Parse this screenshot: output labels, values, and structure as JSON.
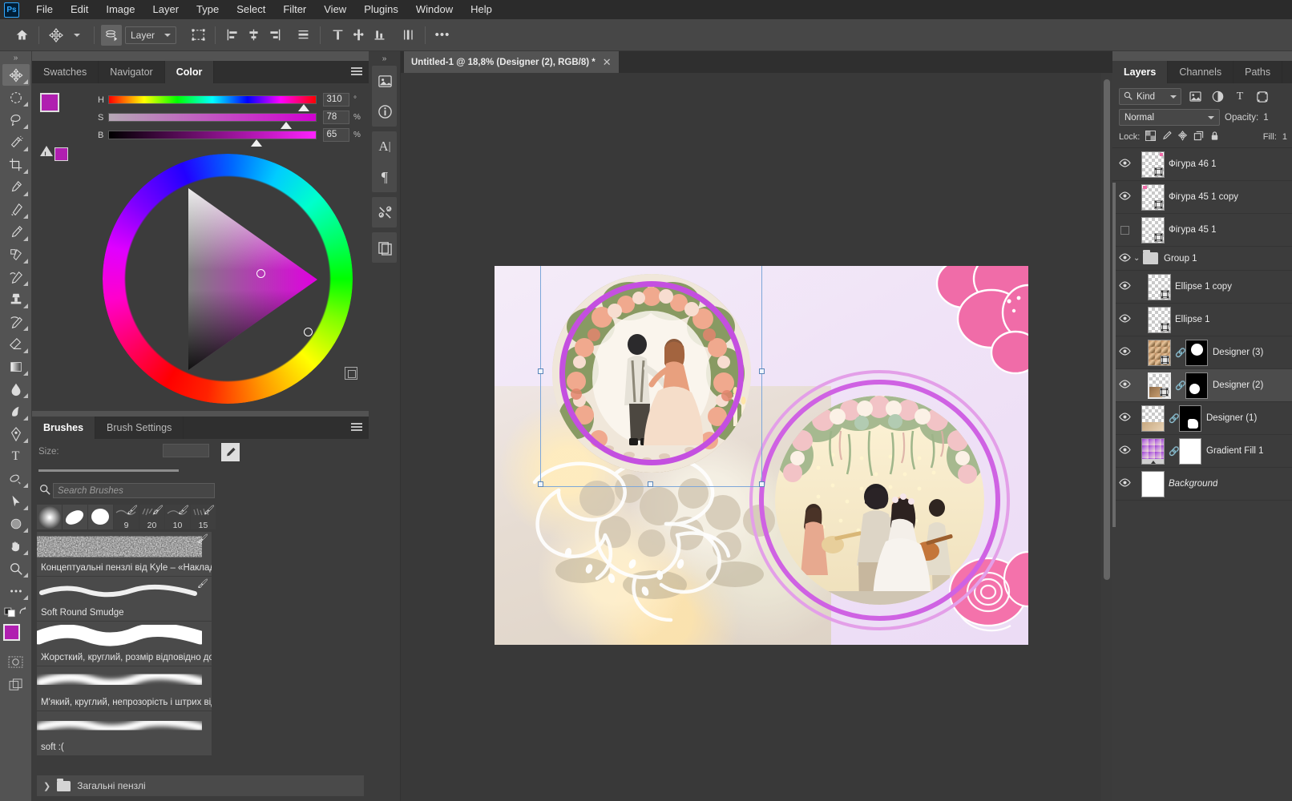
{
  "menubar": {
    "logo": "Ps",
    "items": [
      "File",
      "Edit",
      "Image",
      "Layer",
      "Type",
      "Select",
      "Filter",
      "View",
      "Plugins",
      "Window",
      "Help"
    ]
  },
  "optionsbar": {
    "home_icon": "home-icon",
    "tool_icon": "move-tool-icon",
    "autoselect_icon": "auto-select-icon",
    "layer_select_value": "Layer",
    "transform_icon": "show-transform-controls-icon",
    "align_icons": [
      "align-left-edges-icon",
      "align-horizontal-centers-icon",
      "align-right-edges-icon",
      "align-top-edges-icon"
    ],
    "distribute_icons": [
      "distribute-top-edges-icon",
      "distribute-vertical-centers-icon",
      "distribute-bottom-edges-icon",
      "distribute-left-edges-icon"
    ],
    "more_label": "•••"
  },
  "toolbar": {
    "collapse_label": "»",
    "tools": [
      {
        "name": "move-tool",
        "glyph": "move",
        "active": true
      },
      {
        "name": "elliptical-marquee-tool",
        "glyph": "marquee"
      },
      {
        "name": "lasso-tool",
        "glyph": "lasso"
      },
      {
        "name": "magic-wand-tool",
        "glyph": "wand"
      },
      {
        "name": "crop-tool",
        "glyph": "crop"
      },
      {
        "name": "eyedropper-tool",
        "glyph": "eyedropper"
      },
      {
        "name": "spot-healing-brush-tool",
        "glyph": "healing"
      },
      {
        "name": "brush-tool",
        "glyph": "brush"
      },
      {
        "name": "clone-stamp-tool",
        "glyph": "stamp-pattern"
      },
      {
        "name": "history-brush-tool",
        "glyph": "history-brush"
      },
      {
        "name": "clone-stamp",
        "glyph": "stamp"
      },
      {
        "name": "eraser-tool",
        "glyph": "eraser-alt"
      },
      {
        "name": "gradient-tool",
        "glyph": "gradient"
      },
      {
        "name": "blur-tool",
        "glyph": "blur"
      },
      {
        "name": "dodge-tool",
        "glyph": "dodge"
      },
      {
        "name": "pen-tool",
        "glyph": "pen"
      },
      {
        "name": "type-tool",
        "glyph": "T"
      },
      {
        "name": "path-selection-tool",
        "glyph": "path-sel"
      },
      {
        "name": "direct-selection-tool",
        "glyph": "arrow"
      },
      {
        "name": "ellipse-tool",
        "glyph": "ellipse"
      },
      {
        "name": "hand-tool",
        "glyph": "hand"
      },
      {
        "name": "zoom-tool",
        "glyph": "zoom"
      },
      {
        "name": "edit-toolbar",
        "glyph": "dots"
      }
    ],
    "foreground_color": "#b01fb0",
    "background_color": "#ffffff"
  },
  "color_panel": {
    "tabs": [
      {
        "label": "Swatches",
        "active": false
      },
      {
        "label": "Navigator",
        "active": false
      },
      {
        "label": "Color",
        "active": true
      }
    ],
    "menu_icon": "panel-menu-icon",
    "sliders": [
      {
        "label": "H",
        "value": "310",
        "unit": "°",
        "pos": 86
      },
      {
        "label": "S",
        "value": "78",
        "unit": "%",
        "pos": 78
      },
      {
        "label": "B",
        "value": "65",
        "unit": "%",
        "pos": 65
      }
    ],
    "foreground_color": "#b01fb0",
    "background_color": "#ffffff",
    "out_of_gamut_icon": "gamut-warning-icon",
    "out_of_gamut_color": "#b01fb0"
  },
  "brush_panel": {
    "tabs": [
      {
        "label": "Brushes",
        "active": true
      },
      {
        "label": "Brush Settings",
        "active": false
      }
    ],
    "menu_icon": "panel-menu-icon",
    "size_label": "Size:",
    "size_value": "",
    "edit_icon": "edit-brush-icon",
    "search_placeholder": "Search Brushes",
    "search_value": "",
    "search_icon": "search-icon",
    "presets": [
      {
        "name": "soft-round",
        "num": ""
      },
      {
        "name": "hard-round-angled",
        "num": ""
      },
      {
        "name": "hard-round",
        "num": ""
      },
      {
        "name": "preset-9",
        "num": "9"
      },
      {
        "name": "preset-20",
        "num": "20"
      },
      {
        "name": "preset-10",
        "num": "10"
      },
      {
        "name": "preset-15",
        "num": "15"
      }
    ],
    "brushes": [
      {
        "name": "Концептуальні пензлі від Kyle – «Накладання ...",
        "style": "grain",
        "flag": true
      },
      {
        "name": "Soft Round Smudge",
        "style": "thin-soft",
        "flag": true
      },
      {
        "name": "Жорсткий, круглий, розмір відповідно до тиску",
        "style": "hard-thick",
        "flag": false
      },
      {
        "name": "М'який, круглий, непрозорість і штрих відпові...",
        "style": "soft-thick",
        "flag": false
      },
      {
        "name": "soft :(",
        "style": "soft-thick2",
        "flag": false
      }
    ],
    "folder_label": "Загальні пензлі",
    "folder_icon": "folder-icon"
  },
  "rail": {
    "collapse_label": "»",
    "icons": [
      {
        "name": "libraries-icon"
      },
      {
        "name": "info-icon"
      },
      {
        "name": "character-icon"
      },
      {
        "name": "paragraph-icon"
      },
      {
        "name": "tool-presets-icon"
      },
      {
        "name": "layer-comps-icon"
      }
    ]
  },
  "document": {
    "tab_title": "Untitled-1 @ 18,8% (Designer (2), RGB/8) *",
    "close_icon": "close-icon",
    "zoom_level": "18,8%",
    "color_mode": "RGB/8",
    "active_layer": "Designer (2)",
    "modified": true
  },
  "canvas": {
    "artboard_bg": "#f0e3f7",
    "ring_color": "#c44fe0",
    "flower_color": "#f47ab0",
    "selection_color": "#7da7d9",
    "photo_1_caption": "wedding-couple-floral-arch",
    "photo_2_caption": "wedding-couple-musicians",
    "background_caption": "floral-table-bouquet"
  },
  "layers_panel": {
    "tabs": [
      {
        "label": "Layers",
        "active": true
      },
      {
        "label": "Channels",
        "active": false
      },
      {
        "label": "Paths",
        "active": false
      }
    ],
    "filter": {
      "kind_label": "Kind",
      "search_icon": "search-icon",
      "chevron_icon": "chevron-down-icon",
      "toggles": [
        "filter-pixel-icon",
        "filter-adjustment-icon",
        "filter-type-icon",
        "filter-shape-icon",
        "filter-smart-icon"
      ]
    },
    "blend_mode": "Normal",
    "opacity_label": "Opacity:",
    "opacity_value": "1",
    "lock_label": "Lock:",
    "lock_icons": [
      "lock-transparent-pixels-icon",
      "lock-image-pixels-icon",
      "lock-position-icon",
      "lock-artboard-icon",
      "lock-all-icon"
    ],
    "fill_label": "Fill:",
    "fill_value": "1",
    "layers": [
      {
        "name": "Фігура 46 1",
        "visible": true,
        "type": "shape",
        "indent": 0,
        "selected": false,
        "mask": false
      },
      {
        "name": "Фігура 45 1 copy",
        "visible": true,
        "type": "shape",
        "indent": 0,
        "selected": false,
        "mask": false
      },
      {
        "name": "Фігура 45 1",
        "visible": false,
        "type": "shape",
        "indent": 0,
        "selected": false,
        "mask": false
      },
      {
        "name": "Group 1",
        "visible": true,
        "type": "group",
        "indent": 0,
        "selected": false,
        "mask": false,
        "expanded": true
      },
      {
        "name": "Ellipse 1 copy",
        "visible": true,
        "type": "shape",
        "indent": 1,
        "selected": false,
        "mask": false
      },
      {
        "name": "Ellipse 1",
        "visible": true,
        "type": "shape",
        "indent": 1,
        "selected": false,
        "mask": false
      },
      {
        "name": "Designer (3)",
        "visible": true,
        "type": "image",
        "indent": 1,
        "selected": false,
        "mask": true,
        "mask_shape": "circle-top"
      },
      {
        "name": "Designer (2)",
        "visible": true,
        "type": "image",
        "indent": 1,
        "selected": true,
        "mask": true,
        "mask_shape": "circle-mid"
      },
      {
        "name": "Designer (1)",
        "visible": true,
        "type": "image",
        "indent": 0,
        "selected": false,
        "mask": true,
        "mask_shape": "blob"
      },
      {
        "name": "Gradient Fill 1",
        "visible": true,
        "type": "gradient",
        "indent": 0,
        "selected": false,
        "mask": true,
        "mask_shape": "white"
      },
      {
        "name": "Background",
        "visible": true,
        "type": "background",
        "indent": 0,
        "selected": false,
        "mask": false,
        "italic": true
      }
    ]
  }
}
